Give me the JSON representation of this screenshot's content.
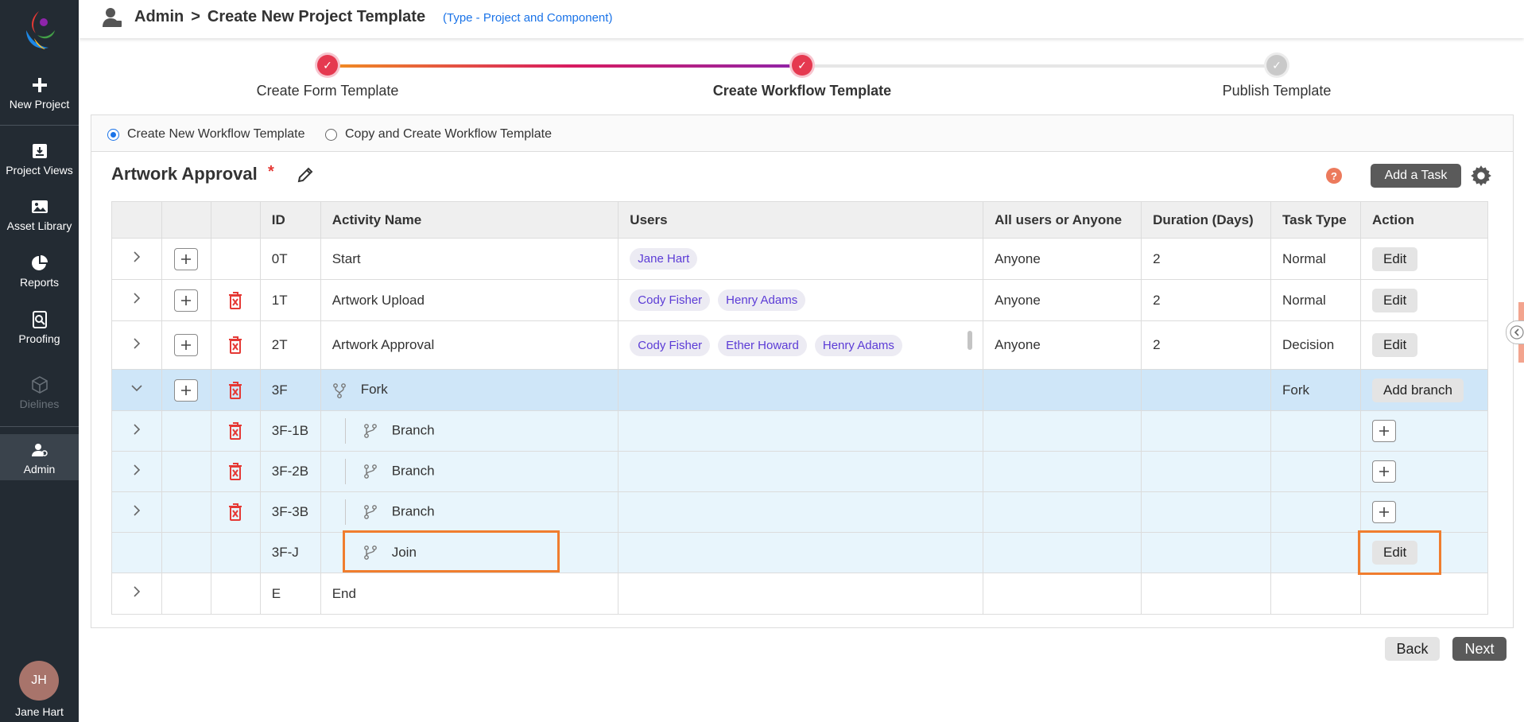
{
  "sidebar": {
    "items": [
      {
        "label": "New Project",
        "icon": "plus-icon"
      },
      {
        "label": "Project Views",
        "icon": "archive-icon"
      },
      {
        "label": "Asset Library",
        "icon": "image-icon"
      },
      {
        "label": "Reports",
        "icon": "pie-chart-icon"
      },
      {
        "label": "Proofing",
        "icon": "proof-search-icon"
      },
      {
        "label": "Dielines",
        "icon": "box-icon"
      },
      {
        "label": "Admin",
        "icon": "admin-user-icon"
      }
    ],
    "user": {
      "initials": "JH",
      "name": "Jane Hart"
    }
  },
  "header": {
    "crumb_root": "Admin",
    "crumb_sep": ">",
    "crumb_current": "Create New Project Template",
    "type_note": "(Type - Project and Component)"
  },
  "stepper": {
    "steps": [
      {
        "label": "Create Form Template",
        "status": "done"
      },
      {
        "label": "Create Workflow Template",
        "status": "current"
      },
      {
        "label": "Publish Template",
        "status": "pending"
      }
    ]
  },
  "options": {
    "create_new": "Create New Workflow Template",
    "copy_create": "Copy and Create Workflow Template",
    "selected": "create_new"
  },
  "workflow": {
    "title": "Artwork Approval",
    "required_mark": "*",
    "help": "?",
    "add_task_label": "Add a Task"
  },
  "table": {
    "headers": {
      "id": "ID",
      "activity": "Activity Name",
      "users": "Users",
      "all_any": "All users or Anyone",
      "duration": "Duration (Days)",
      "task_type": "Task Type",
      "action": "Action"
    },
    "rows": [
      {
        "id": "0T",
        "activity": "Start",
        "users": [
          "Jane Hart"
        ],
        "all_any": "Anyone",
        "duration": "2",
        "task_type": "Normal",
        "action": "Edit"
      },
      {
        "id": "1T",
        "activity": "Artwork Upload",
        "users": [
          "Cody Fisher",
          "Henry Adams"
        ],
        "all_any": "Anyone",
        "duration": "2",
        "task_type": "Normal",
        "action": "Edit"
      },
      {
        "id": "2T",
        "activity": "Artwork Approval",
        "users": [
          "Cody Fisher",
          "Ether Howard",
          "Henry Adams"
        ],
        "all_any": "Anyone",
        "duration": "2",
        "task_type": "Decision",
        "action": "Edit"
      },
      {
        "id": "3F",
        "activity": "Fork",
        "task_type": "Fork",
        "action": "Add branch"
      },
      {
        "id": "3F-1B",
        "activity": "Branch"
      },
      {
        "id": "3F-2B",
        "activity": "Branch"
      },
      {
        "id": "3F-3B",
        "activity": "Branch"
      },
      {
        "id": "3F-J",
        "activity": "Join",
        "action": "Edit"
      },
      {
        "id": "E",
        "activity": "End"
      }
    ]
  },
  "footer": {
    "back_label": "Back",
    "next_label": "Next"
  },
  "colors": {
    "sidebar_bg": "#232b33",
    "accent": "#1a73e8",
    "highlight": "#f07d2e",
    "delete": "#e53935",
    "chip_text": "#5b3bd6"
  }
}
